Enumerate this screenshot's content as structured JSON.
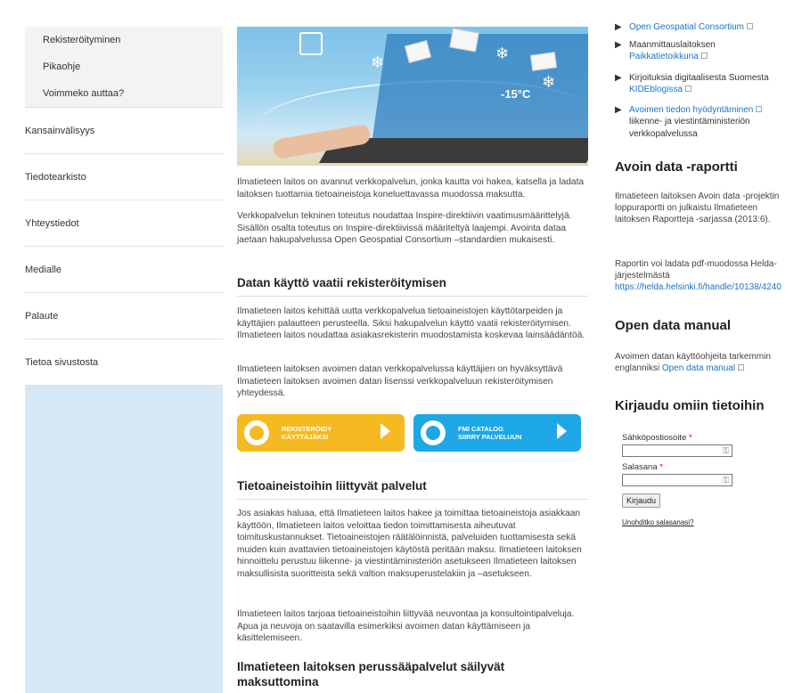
{
  "sidebar": {
    "sub_items": [
      "Rekisteröityminen",
      "Pikaohje",
      "Voimmeko auttaa?"
    ],
    "items": [
      "Kansainvälisyys",
      "Tiedotearkisto",
      "Yhteystiedot",
      "Medialle",
      "Palaute",
      "Tietoa sivustosta"
    ]
  },
  "hero": {
    "temperature": "-15°C"
  },
  "main": {
    "p1": "Ilmatieteen laitos on avannut verkkopalvelun, jonka kautta voi hakea, katsella ja ladata laitoksen tuottamia tietoaineistoja koneluettavassa muodossa maksutta.",
    "p2": "Verkkopalvelun tekninen toteutus noudattaa Inspire-direktiivin vaatimusmäärittelyjä. Sisällön osalta toteutus on Inspire-direktiivissä määriteltyä laajempi. Avointa dataa jaetaan hakupalvelussa Open Geospatial Consortium –standardien mukaisesti.",
    "h1": "Datan käyttö vaatii rekisteröitymisen",
    "p3": "Ilmatieteen laitos kehittää uutta verkkopalvelua tietoaineistojen käyttötarpeiden ja käyttäjien palautteen perusteella. Siksi hakupalvelun käyttö vaatii rekisteröitymisen. Ilmatieteen laitos noudattaa asiakasrekisterin muodostamista koskevaa lainsäädäntöä.",
    "p4": "Ilmatieteen laitoksen avoimen datan verkkopalvelussa käyttäjien on hyväksyttävä Ilmatieteen laitoksen avoimen datan lisenssi verkkopalveluun rekisteröitymisen yhteydessä.",
    "cta_register_line1": "REKISTERÖIDY",
    "cta_register_line2": "KÄYTTÄJÄKSI",
    "cta_catalog_line1": "FMI CATALOG",
    "cta_catalog_line2": "SIIRRY PALVELUUN",
    "h2": "Tietoaineistoihin liittyvät palvelut",
    "p5": "Jos asiakas haluaa, että Ilmatieteen laitos hakee ja toimittaa tietoaineistoja asiakkaan käyttöön, Ilmatieteen laitos veloittaa tiedon toimittamisesta aiheutuvat toimituskustannukset. Tietoaineistojen räätälöinnistä, palveluiden tuottamisesta sekä muiden kuin avattavien tietoaineistojen käytöstä peritään maksu.  Ilmatieteen laitoksen hinnoittelu perustuu liikenne- ja viestintäministeriön asetukseen Ilmatieteen laitoksen maksullisista suoritteista sekä valtion maksuperustelakiin ja –asetukseen.",
    "p6": "Ilmatieteen laitos tarjoaa tietoaineistoihin liittyvää neuvontaa ja konsultointipalveluja. Apua ja neuvoja on saatavilla esimerkiksi avoimen datan käyttämiseen ja käsittelemiseen.",
    "h3_line1": "Ilmatieteen laitoksen perussääpalvelut säilyvät",
    "h3_line2": "maksuttomina"
  },
  "right": {
    "links": [
      {
        "before": "",
        "link": "Open Geospatial Consortium",
        "after": ""
      },
      {
        "before": "Maanmittauslaitoksen ",
        "link": "Paikkatietoikkuna",
        "after": ""
      },
      {
        "before": "Kirjoituksia digitaalisesta Suomesta ",
        "link": "KIDEblogissa",
        "after": ""
      },
      {
        "before": "",
        "link": "Avoimen tiedon hyödyntäminen",
        "after": " liikenne- ja viestintäministeriön verkkopalvelussa"
      }
    ],
    "report_heading": "Avoin data -raportti",
    "report_p1": "Ilmatieteen laitoksen Avoin data -projektin loppuraportti on julkaistu Ilmatieteen laitoksen Raportteja -sarjassa (2013:6).",
    "report_p2": "Raportin voi ladata pdf-muodossa Helda-järjestelmästä",
    "report_link": "https://helda.helsinki.fi/handle/10138/4240",
    "manual_heading": "Open data manual",
    "manual_text": "Avoimen datan käyttöohjeita tarkemmin englanniksi ",
    "manual_link": "Open data manual",
    "login_heading": "Kirjaudu omiin tietoihin",
    "email_label": "Sähköpostiosoite",
    "password_label": "Salasana",
    "required_mark": "*",
    "login_button": "Kirjaudu",
    "forgot_link": "Unohditko salasanasi?"
  },
  "colors": {
    "sidebar_bg": "#d6e8f6",
    "cta_yellow": "#f5b921",
    "cta_blue": "#1da7e6",
    "link": "#1a73c9"
  }
}
